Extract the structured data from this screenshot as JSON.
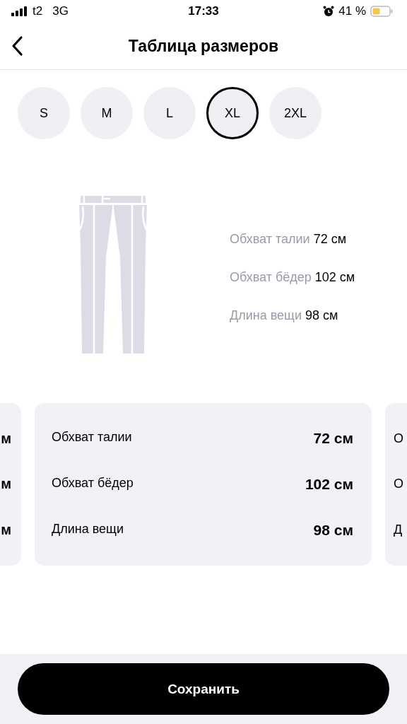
{
  "status_bar": {
    "carrier": "t2",
    "network": "3G",
    "time": "17:33",
    "battery_percent": "41 %"
  },
  "header": {
    "title": "Таблица размеров"
  },
  "sizes": [
    {
      "label": "S",
      "selected": false
    },
    {
      "label": "M",
      "selected": false
    },
    {
      "label": "L",
      "selected": false
    },
    {
      "label": "XL",
      "selected": true
    },
    {
      "label": "2XL",
      "selected": false
    }
  ],
  "measurements": [
    {
      "label": "Обхват талии",
      "value": "72 см"
    },
    {
      "label": "Обхват бёдер",
      "value": "102 см"
    },
    {
      "label": "Длина вещи",
      "value": "98 см"
    }
  ],
  "cards": [
    {
      "kind": "partial_right",
      "rows": [
        {
          "value": "м"
        },
        {
          "value": "м"
        },
        {
          "value": "м"
        }
      ]
    },
    {
      "kind": "full",
      "rows": [
        {
          "label": "Обхват талии",
          "value": "72 см"
        },
        {
          "label": "Обхват бёдер",
          "value": "102 см"
        },
        {
          "label": "Длина вещи",
          "value": "98 см"
        }
      ]
    },
    {
      "kind": "partial_left",
      "rows": [
        {
          "label": "О"
        },
        {
          "label": "О"
        },
        {
          "label": "Д"
        }
      ]
    }
  ],
  "save_button": {
    "label": "Сохранить"
  }
}
